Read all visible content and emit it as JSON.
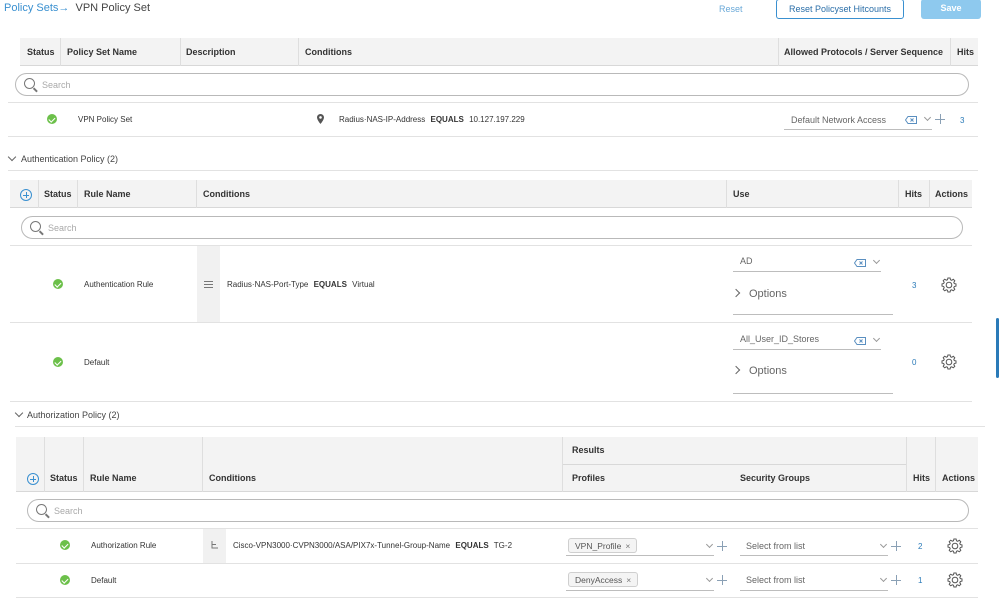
{
  "breadcrumb": {
    "parent": "Policy Sets",
    "arrow": "→",
    "current": "VPN Policy Set"
  },
  "toolbar": {
    "reset": "Reset",
    "reset_hitcounts": "Reset Policyset Hitcounts",
    "save": "Save"
  },
  "policy_sets": {
    "headers": {
      "status": "Status",
      "name": "Policy Set Name",
      "description": "Description",
      "conditions": "Conditions",
      "allowed": "Allowed Protocols / Server Sequence",
      "hits": "Hits"
    },
    "search_placeholder": "Search",
    "row": {
      "name": "VPN Policy Set",
      "cond_attr": "Radius·NAS-IP-Address",
      "cond_op": "EQUALS",
      "cond_value": "10.127.197.229",
      "allowed": "Default Network Access",
      "hits": "3"
    }
  },
  "authentication": {
    "title": "Authentication Policy (2)",
    "headers": {
      "status": "Status",
      "rule": "Rule Name",
      "conditions": "Conditions",
      "use": "Use",
      "hits": "Hits",
      "actions": "Actions"
    },
    "search_placeholder": "Search",
    "rows": [
      {
        "name": "Authentication Rule",
        "cond_attr": "Radius·NAS-Port-Type",
        "cond_op": "EQUALS",
        "cond_value": "Virtual",
        "use": "AD",
        "options": "Options",
        "hits": "3"
      },
      {
        "name": "Default",
        "use": "All_User_ID_Stores",
        "options": "Options",
        "hits": "0"
      }
    ]
  },
  "authorization": {
    "title": "Authorization Policy (2)",
    "headers": {
      "results": "Results",
      "status": "Status",
      "rule": "Rule Name",
      "conditions": "Conditions",
      "profiles": "Profiles",
      "security_groups": "Security Groups",
      "hits": "Hits",
      "actions": "Actions"
    },
    "search_placeholder": "Search",
    "rows": [
      {
        "name": "Authorization Rule",
        "cond_attr": "Cisco-VPN3000·CVPN3000/ASA/PIX7x-Tunnel-Group-Name",
        "cond_op": "EQUALS",
        "cond_value": "TG-2",
        "profile": "VPN_Profile",
        "sg": "Select from list",
        "hits": "2"
      },
      {
        "name": "Default",
        "profile": "DenyAccess",
        "sg": "Select from list",
        "hits": "1"
      }
    ]
  },
  "colors": {
    "accent": "#3a90d0",
    "ok": "#6cc04a",
    "save_bg": "#8ec9ee"
  }
}
